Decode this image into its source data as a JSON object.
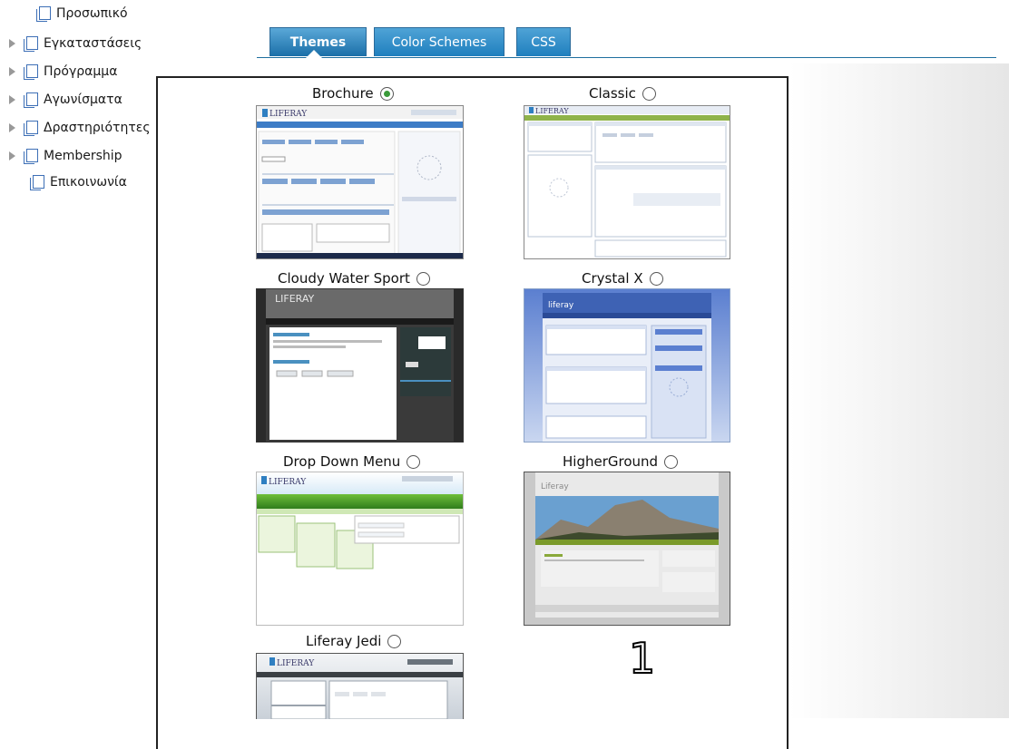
{
  "tree": {
    "items": [
      {
        "label": "Προσωπικό",
        "expandable": false
      },
      {
        "label": "Εγκαταστάσεις",
        "expandable": true
      },
      {
        "label": "Πρόγραμμα",
        "expandable": true
      },
      {
        "label": "Αγωνίσματα",
        "expandable": true
      },
      {
        "label": "Δραστηριότητες",
        "expandable": true
      },
      {
        "label": "Membership",
        "expandable": true
      },
      {
        "label": "Επικοινωνία",
        "expandable": false
      }
    ]
  },
  "tabs": {
    "items": [
      {
        "label": "Themes",
        "active": true
      },
      {
        "label": "Color Schemes",
        "active": false
      },
      {
        "label": "CSS",
        "active": false
      }
    ]
  },
  "themes": {
    "items": [
      {
        "name": "Brochure",
        "selected": true,
        "thumb_brand": "LIFERAY"
      },
      {
        "name": "Classic",
        "selected": false,
        "thumb_brand": "LIFERAY"
      },
      {
        "name": "Cloudy Water Sport",
        "selected": false,
        "thumb_brand": "LIFERAY"
      },
      {
        "name": "Crystal X",
        "selected": false,
        "thumb_brand": "liferay"
      },
      {
        "name": "Drop Down Menu",
        "selected": false,
        "thumb_brand": "LIFERAY"
      },
      {
        "name": "HigherGround",
        "selected": false,
        "thumb_brand": "Liferay"
      },
      {
        "name": "Liferay Jedi",
        "selected": false,
        "thumb_brand": "LIFERAY"
      }
    ]
  },
  "annotation": {
    "marker": "1"
  },
  "colors": {
    "tab_blue": "#1f7fbe",
    "radio_selected": "#3a9a3a",
    "tree_icon": "#3d6fb6"
  }
}
